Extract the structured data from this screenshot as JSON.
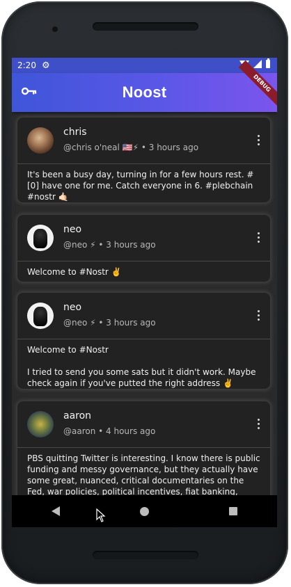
{
  "status": {
    "time": "2:20"
  },
  "app": {
    "title": "Noost",
    "debug_label": "DEBUG"
  },
  "posts": [
    {
      "name": "chris",
      "meta": "@chris o'neal 🇺🇸⚡ • 3 hours ago",
      "body": "It's been a busy day, turning in for a few hours rest. #[0] have one for me. Catch everyone in 6. #plebchain #nostr 🤙🏻"
    },
    {
      "name": "neo",
      "meta": "@neo ⚡ • 3 hours ago",
      "body": "Welcome to #Nostr ✌️"
    },
    {
      "name": "neo",
      "meta": "@neo ⚡ • 3 hours ago",
      "body": "Welcome to #Nostr\n\nI tried to send you some sats but it didn't work. Maybe check again if you've putted the right address ✌️"
    },
    {
      "name": "aaron",
      "meta": "@aaron • 4 hours ago",
      "body": "PBS quitting Twitter is interesting. I know there is public funding and messy governance, but they actually have some great, nuanced, critical documentaries on the Fed, war policies, political incentives, fiat banking, current"
    }
  ]
}
